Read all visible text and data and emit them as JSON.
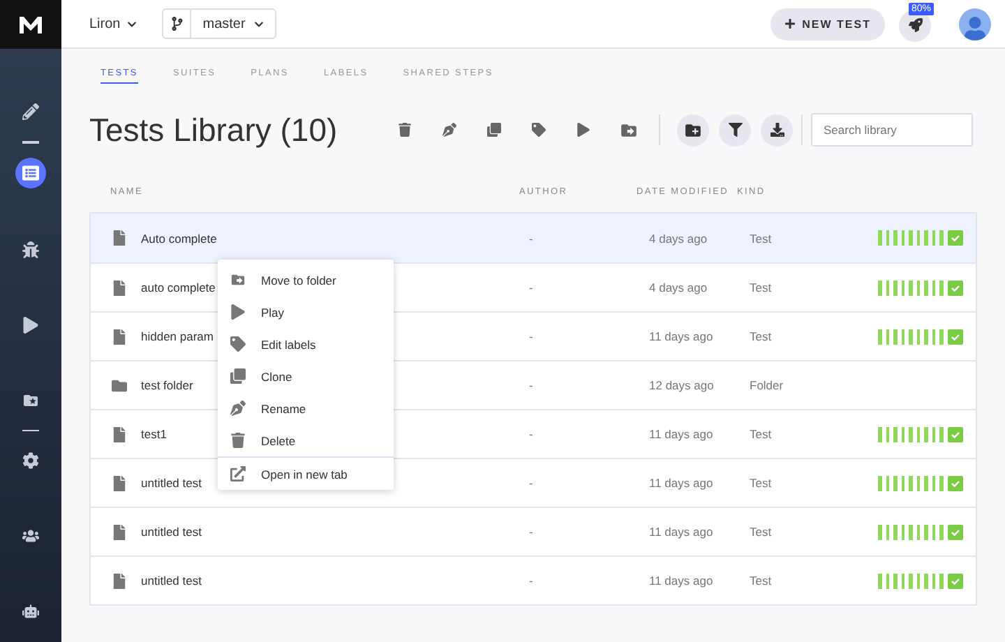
{
  "topbar": {
    "user": "Liron",
    "branch": "master",
    "new_test": "NEW TEST",
    "progress_badge": "80%"
  },
  "sidebar": {
    "items": [
      {
        "selected": false
      },
      {
        "selected": true
      },
      {
        "selected": false
      },
      {
        "selected": false
      },
      {
        "selected": false
      },
      {
        "selected": false
      },
      {
        "selected": false
      },
      {
        "selected": false
      }
    ]
  },
  "tabs": [
    {
      "label": "TESTS",
      "selected": true
    },
    {
      "label": "SUITES",
      "selected": false
    },
    {
      "label": "PLANS",
      "selected": false
    },
    {
      "label": "LABELS",
      "selected": false
    },
    {
      "label": "SHARED STEPS",
      "selected": false
    }
  ],
  "title": "Tests Library (10)",
  "search": {
    "placeholder": "Search library"
  },
  "table": {
    "columns": [
      "NAME",
      "AUTHOR",
      "DATE MODIFIED",
      "KIND"
    ],
    "rows": [
      {
        "kind": "file",
        "name": "Auto complete",
        "author": "-",
        "date": "4 days ago",
        "type": "Test",
        "passed": true,
        "selected": true
      },
      {
        "kind": "file",
        "name": "auto complete",
        "author": "-",
        "date": "4 days ago",
        "type": "Test",
        "passed": true,
        "selected": false
      },
      {
        "kind": "file",
        "name": "hidden param",
        "author": "-",
        "date": "11 days ago",
        "type": "Test",
        "passed": true,
        "selected": false
      },
      {
        "kind": "folder",
        "name": "test folder",
        "author": "-",
        "date": "12 days ago",
        "type": "Folder",
        "selected": false
      },
      {
        "kind": "file",
        "name": "test1",
        "author": "-",
        "date": "11 days ago",
        "type": "Test",
        "passed": true,
        "selected": false
      },
      {
        "kind": "file",
        "name": "untitled test",
        "author": "-",
        "date": "11 days ago",
        "type": "Test",
        "passed": true,
        "selected": false
      },
      {
        "kind": "file",
        "name": "untitled test",
        "author": "-",
        "date": "11 days ago",
        "type": "Test",
        "passed": true,
        "selected": false
      },
      {
        "kind": "file",
        "name": "untitled test",
        "author": "-",
        "date": "11 days ago",
        "type": "Test",
        "passed": true,
        "selected": false
      }
    ]
  },
  "context_menu": {
    "groups": [
      [
        "Move to folder",
        "Play",
        "Edit labels",
        "Clone",
        "Rename",
        "Delete"
      ],
      [
        "Open in new tab"
      ]
    ]
  }
}
